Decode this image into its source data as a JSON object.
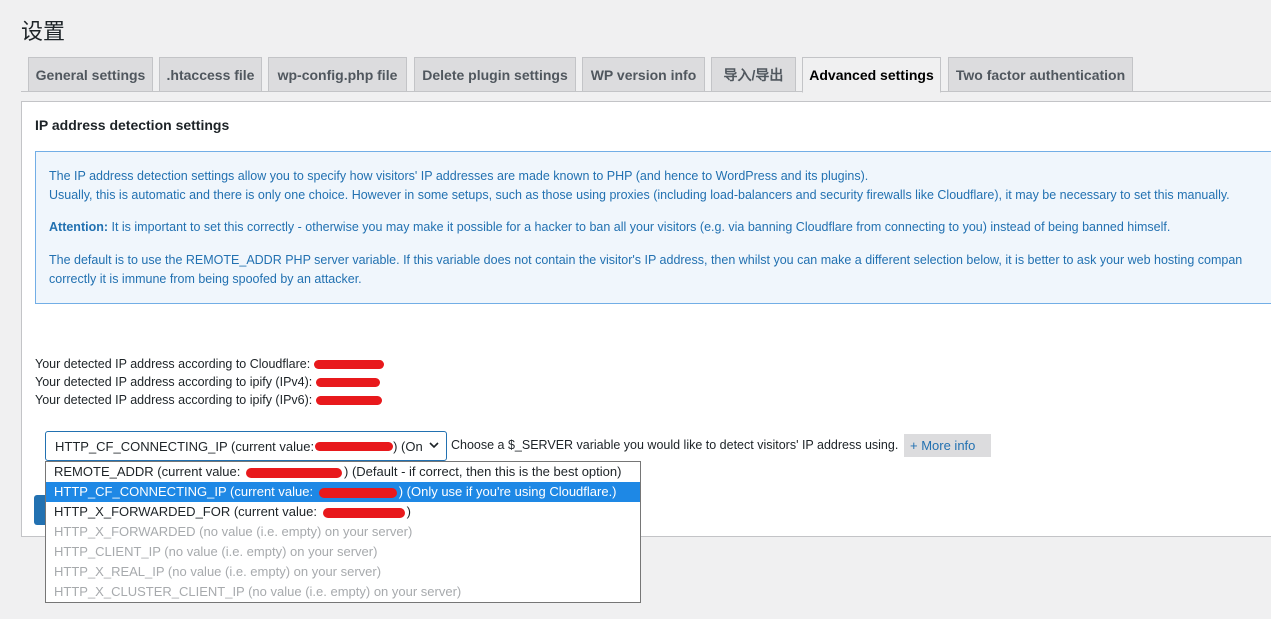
{
  "page_title": "设置",
  "tabs": [
    {
      "label": "General settings",
      "active": false
    },
    {
      "label": ".htaccess file",
      "active": false
    },
    {
      "label": "wp-config.php file",
      "active": false
    },
    {
      "label": "Delete plugin settings",
      "active": false
    },
    {
      "label": "WP version info",
      "active": false
    },
    {
      "label": "导入/导出",
      "active": false
    },
    {
      "label": "Advanced settings",
      "active": true
    },
    {
      "label": "Two factor authentication",
      "active": false
    }
  ],
  "panel": {
    "heading": "IP address detection settings",
    "notice": {
      "line1": "The IP address detection settings allow you to specify how visitors' IP addresses are made known to PHP (and hence to WordPress and its plugins).",
      "line2": "Usually, this is automatic and there is only one choice. However in some setups, such as those using proxies (including load-balancers and security firewalls like Cloudflare), it may be necessary to set this manually.",
      "attention_label": "Attention:",
      "attention_text": " It is important to set this correctly - otherwise you may make it possible for a hacker to ban all your visitors (e.g. via banning Cloudflare from connecting to you) instead of being banned himself.",
      "default_line1": "The default is to use the REMOTE_ADDR PHP server variable. If this variable does not contain the visitor's IP address, then whilst you can make a different selection below, it is better to ask your web hosting compan",
      "default_line2": "correctly it is immune from being spoofed by an attacker."
    },
    "ip_detected": {
      "cloudflare": "Your detected IP address according to Cloudflare:",
      "ipify_v4": "Your detected IP address according to ipify (IPv4):",
      "ipify_v6": "Your detected IP address according to ipify (IPv6):"
    },
    "select": {
      "value": "HTTP_CF_CONNECTING_IP (current value: ",
      "value_suffix": ") (On"
    },
    "help_text": "Choose a $_SERVER variable you would like to detect visitors' IP address using.",
    "more_info": "+ More info"
  },
  "dropdown_options": [
    {
      "prefix": "REMOTE_ADDR (current value: ",
      "suffix": ") (Default - if correct, then this is the best option)",
      "redacted": true,
      "state": "normal"
    },
    {
      "prefix": "HTTP_CF_CONNECTING_IP (current value: ",
      "suffix": ") (Only use if you're using Cloudflare.)",
      "redacted": true,
      "state": "selected"
    },
    {
      "prefix": "HTTP_X_FORWARDED_FOR (current value: ",
      "suffix": ")",
      "redacted": true,
      "state": "normal"
    },
    {
      "prefix": "HTTP_X_FORWARDED (no value (i.e. empty) on your server)",
      "suffix": "",
      "redacted": false,
      "state": "disabled"
    },
    {
      "prefix": "HTTP_CLIENT_IP (no value (i.e. empty) on your server)",
      "suffix": "",
      "redacted": false,
      "state": "disabled"
    },
    {
      "prefix": "HTTP_X_REAL_IP (no value (i.e. empty) on your server)",
      "suffix": "",
      "redacted": false,
      "state": "disabled"
    },
    {
      "prefix": "HTTP_X_CLUSTER_CLIENT_IP (no value (i.e. empty) on your server)",
      "suffix": "",
      "redacted": false,
      "state": "disabled"
    }
  ],
  "colors": {
    "accent": "#2271b1",
    "selected_option": "#1e88e5",
    "redaction": "#e8191c",
    "notice_bg": "#f0f6fc"
  }
}
